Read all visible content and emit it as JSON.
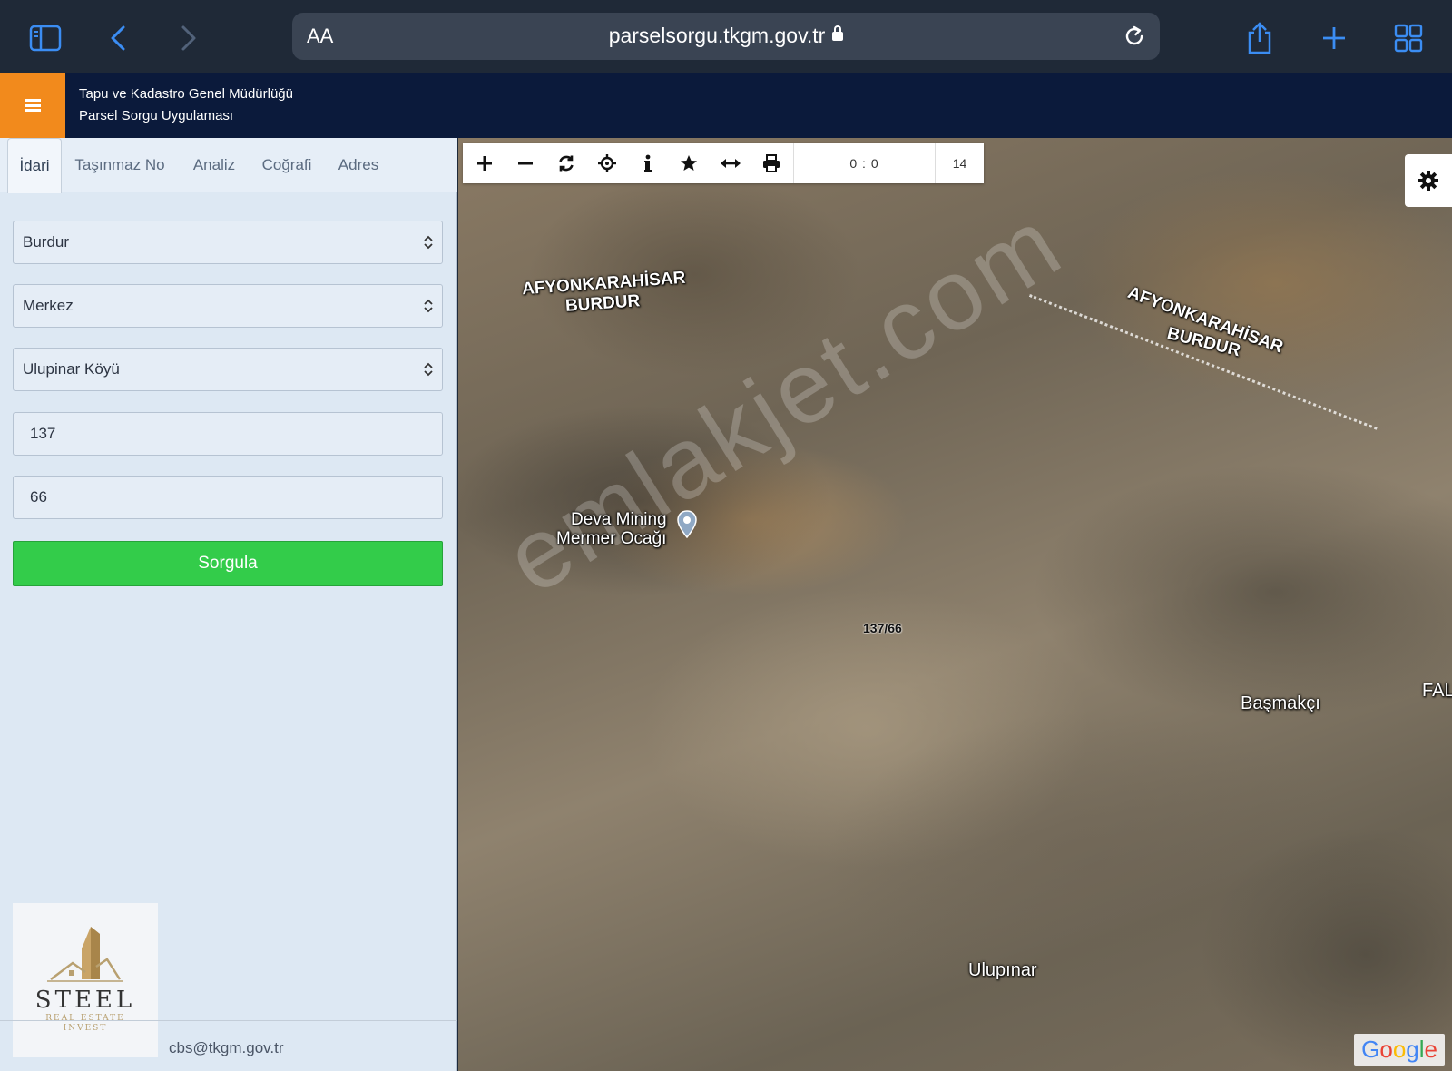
{
  "browser": {
    "url": "parselsorgu.tkgm.gov.tr",
    "text_size_label": "AA"
  },
  "header": {
    "org_name": "Tapu ve Kadastro Genel Müdürlüğü",
    "app_name": "Parsel Sorgu Uygulaması"
  },
  "tabs": [
    {
      "label": "İdari",
      "active": true
    },
    {
      "label": "Taşınmaz No",
      "active": false
    },
    {
      "label": "Analiz",
      "active": false
    },
    {
      "label": "Coğrafi",
      "active": false
    },
    {
      "label": "Adres",
      "active": false
    }
  ],
  "form": {
    "province": "Burdur",
    "district": "Merkez",
    "village": "Ulupinar Köyü",
    "block_no": "137",
    "parcel_no": "66",
    "submit_label": "Sorgula"
  },
  "footer": {
    "email": "cbs@tkgm.gov.tr"
  },
  "logo": {
    "name": "STEEL",
    "sub1": "REAL ESTATE",
    "sub2": "INVEST"
  },
  "map": {
    "coords": "0 : 0",
    "zoom": "14",
    "labels": {
      "region_left_1": "AFYONKARAHİSAR",
      "region_left_2": "BURDUR",
      "region_right_1": "AFYONKARAHİSAR",
      "region_right_2": "BURDUR",
      "poi_1": "Deva Mining",
      "poi_2": "Mermer Ocağı",
      "parcel": "137/66",
      "village_1": "Başmakçı",
      "village_2": "Ulupınar",
      "edge": "FAL"
    },
    "watermark": "emlakjet.com",
    "attribution": "Google"
  },
  "icons": [
    "sidebar-icon",
    "back-icon",
    "forward-icon",
    "lock-icon",
    "reload-icon",
    "share-icon",
    "new-tab-icon",
    "tabs-overview-icon",
    "menu-icon",
    "zoom-in-icon",
    "zoom-out-icon",
    "refresh-icon",
    "locate-icon",
    "info-icon",
    "favorite-icon",
    "measure-icon",
    "print-icon",
    "settings-icon",
    "map-pin-icon"
  ],
  "colors": {
    "header_bg": "#0b1a3b",
    "menu_accent": "#f28a1c",
    "submit_green": "#33cc4a",
    "safari_blue": "#3b8df3"
  }
}
